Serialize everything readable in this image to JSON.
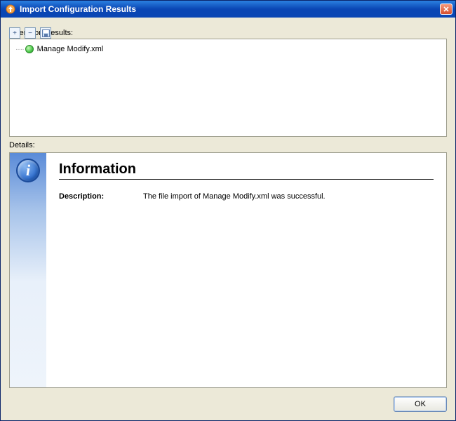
{
  "window": {
    "title": "Import Configuration Results"
  },
  "operation_results": {
    "label": "Operation Results:",
    "items": [
      {
        "label": "Manage Modify.xml",
        "status": "success"
      }
    ]
  },
  "toolbar": {
    "expand_all": "+",
    "collapse_all": "−",
    "save": ""
  },
  "details": {
    "label": "Details:",
    "heading": "Information",
    "description_label": "Description:",
    "description_text": "The file import of Manage Modify.xml was successful."
  },
  "buttons": {
    "ok": "OK"
  },
  "icons": {
    "info_glyph": "i"
  }
}
